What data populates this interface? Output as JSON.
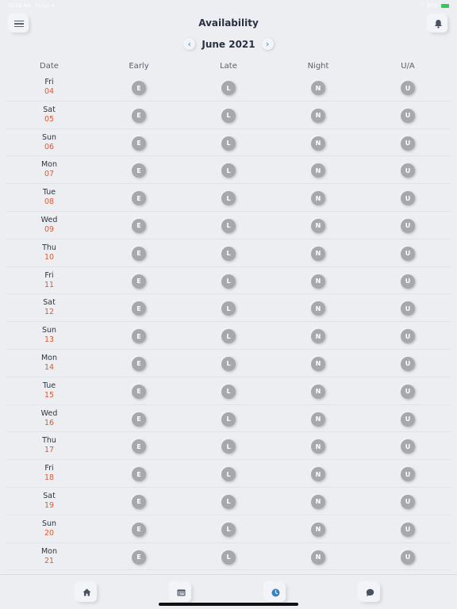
{
  "status_bar": {
    "time": "10:58 AM",
    "date": "Fri Jun 4",
    "battery": "87%"
  },
  "header": {
    "title": "Availability",
    "menu_icon": "hamburger-icon",
    "bell_icon": "bell-icon"
  },
  "month_nav": {
    "label": "June 2021",
    "prev_icon": "chevron-left-icon",
    "next_icon": "chevron-right-icon"
  },
  "table": {
    "columns": [
      "Date",
      "Early",
      "Late",
      "Night",
      "U/A"
    ],
    "shift_letters": [
      "E",
      "L",
      "N",
      "U"
    ],
    "rows": [
      {
        "day": "Fri",
        "date": "04"
      },
      {
        "day": "Sat",
        "date": "05"
      },
      {
        "day": "Sun",
        "date": "06"
      },
      {
        "day": "Mon",
        "date": "07"
      },
      {
        "day": "Tue",
        "date": "08"
      },
      {
        "day": "Wed",
        "date": "09"
      },
      {
        "day": "Thu",
        "date": "10"
      },
      {
        "day": "Fri",
        "date": "11"
      },
      {
        "day": "Sat",
        "date": "12"
      },
      {
        "day": "Sun",
        "date": "13"
      },
      {
        "day": "Mon",
        "date": "14"
      },
      {
        "day": "Tue",
        "date": "15"
      },
      {
        "day": "Wed",
        "date": "16"
      },
      {
        "day": "Thu",
        "date": "17"
      },
      {
        "day": "Fri",
        "date": "18"
      },
      {
        "day": "Sat",
        "date": "19"
      },
      {
        "day": "Sun",
        "date": "20"
      },
      {
        "day": "Mon",
        "date": "21"
      }
    ]
  },
  "tab_bar": {
    "items": [
      {
        "icon": "home-icon"
      },
      {
        "icon": "calendar-icon"
      },
      {
        "icon": "clock-icon"
      },
      {
        "icon": "chat-icon"
      }
    ]
  },
  "colors": {
    "background": "#eceef2",
    "date_number": "#e2572f",
    "shift_button": "#a6a8ac",
    "accent": "#3b82c4"
  }
}
